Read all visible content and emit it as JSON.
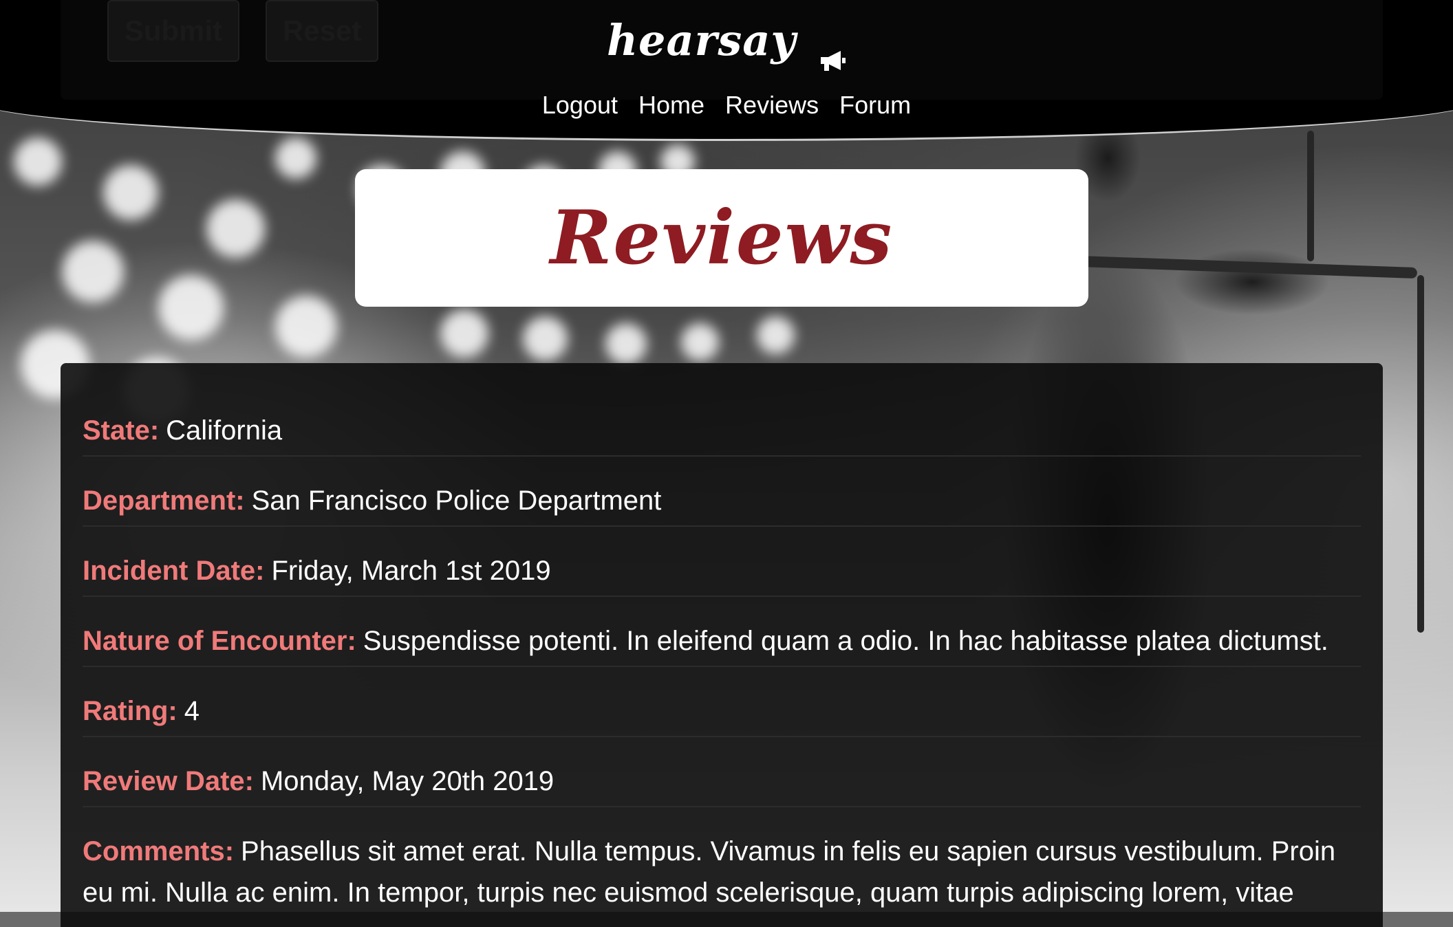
{
  "header": {
    "brand": "hearsay",
    "nav": [
      "Logout",
      "Home",
      "Reviews",
      "Forum"
    ],
    "hidden_form_buttons": [
      "Submit",
      "Reset"
    ]
  },
  "page_title": "Reviews",
  "review": {
    "state": {
      "label": "State:",
      "value": "California"
    },
    "department": {
      "label": "Department:",
      "value": "San Francisco Police Department"
    },
    "incident_date": {
      "label": "Incident Date:",
      "value": "Friday, March 1st 2019"
    },
    "nature": {
      "label": "Nature of Encounter:",
      "value": "Suspendisse potenti. In eleifend quam a odio. In hac habitasse platea dictumst."
    },
    "rating": {
      "label": "Rating:",
      "value": "4"
    },
    "review_date": {
      "label": "Review Date:",
      "value": "Monday, May 20th 2019"
    },
    "comments": {
      "label": "Comments:",
      "value": "Phasellus sit amet erat. Nulla tempus. Vivamus in felis eu sapien cursus vestibulum. Proin eu mi. Nulla ac enim. In tempor, turpis nec euismod scelerisque, quam turpis adipiscing lorem, vitae"
    }
  },
  "colors": {
    "label": "#f07a7a",
    "title": "#8e1c22",
    "header_bg": "#000000",
    "panel_bg": "#0c0c0c"
  },
  "icons": [
    "megaphone-icon"
  ]
}
